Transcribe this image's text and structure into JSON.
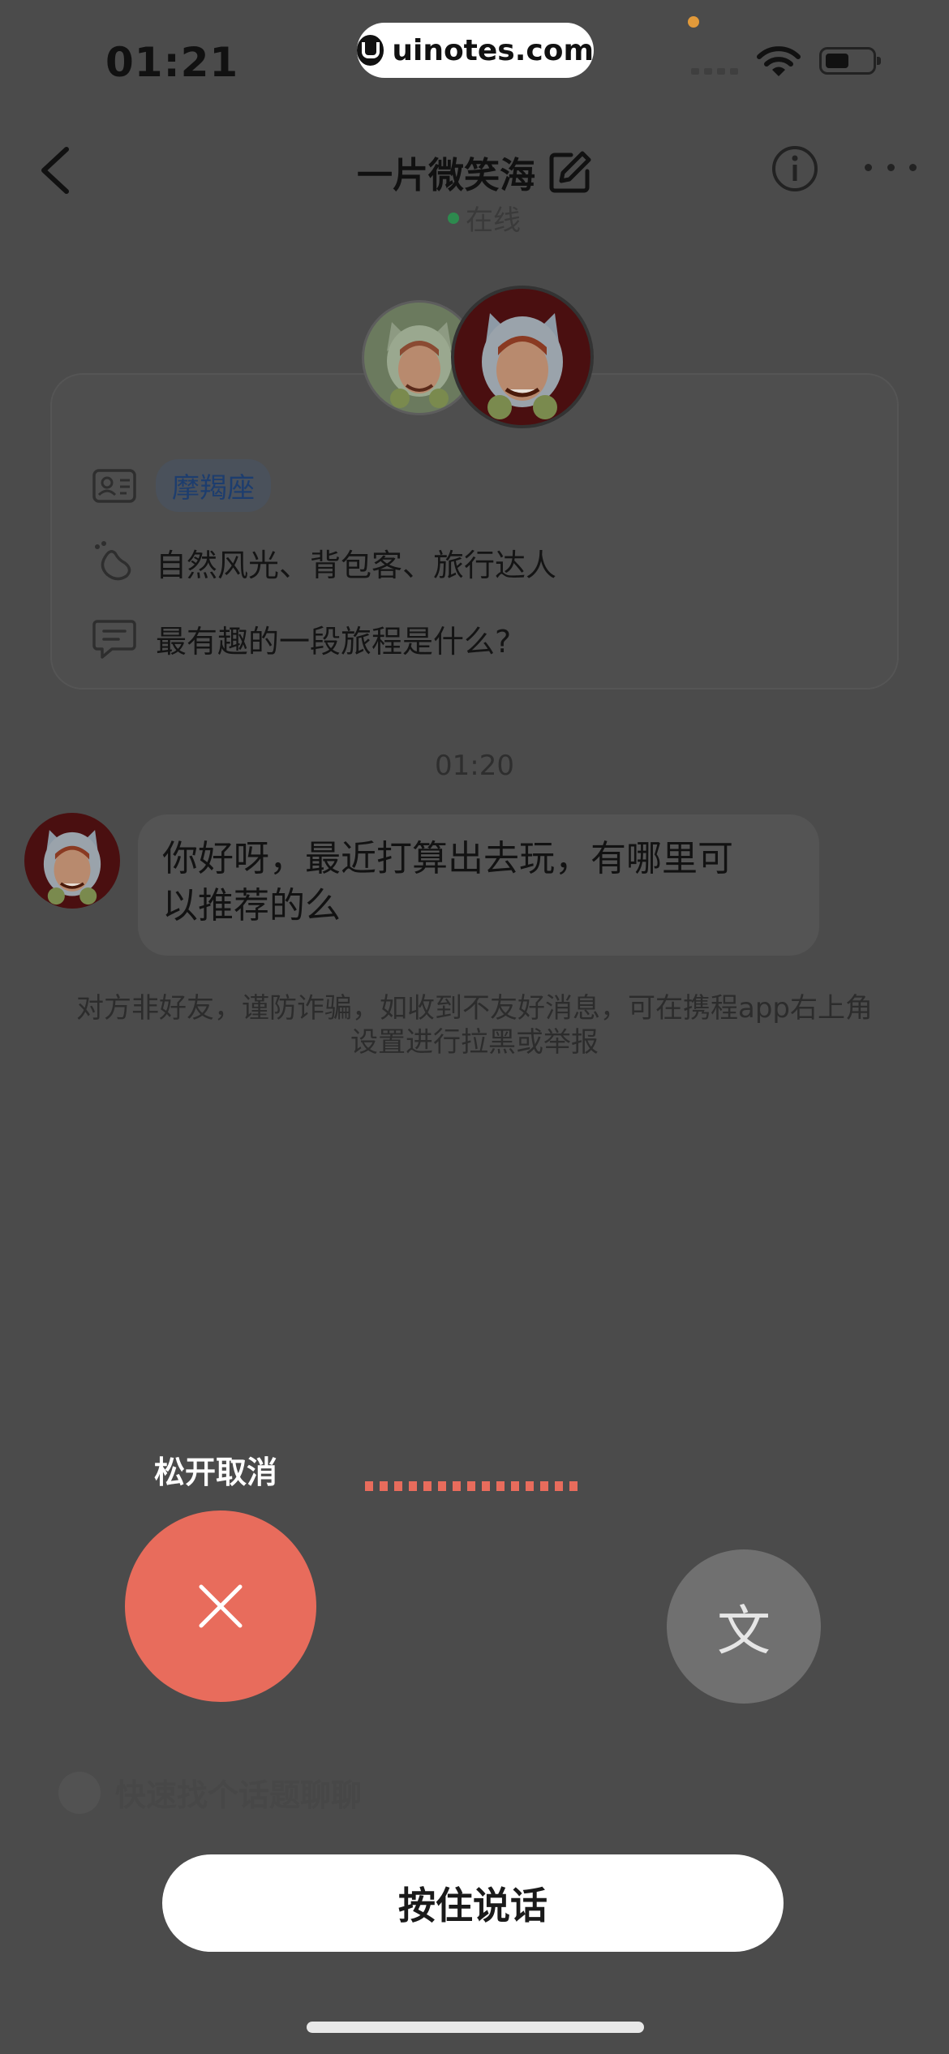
{
  "status_bar": {
    "time": "01:21",
    "watermark": "uinotes.com",
    "icons": [
      "signal-icon",
      "wifi-icon",
      "battery-icon"
    ]
  },
  "header": {
    "title": "一片微笑海",
    "status": "在线",
    "icons": [
      "back-icon",
      "edit-icon",
      "info-icon",
      "more-icon"
    ]
  },
  "profile": {
    "zodiac": "摩羯座",
    "interests": "自然风光、背包客、旅行达人",
    "question": "最有趣的一段旅程是什么?"
  },
  "chat": {
    "timestamp": "01:20",
    "message_line1": "你好呀，最近打算出去玩，有哪里可",
    "message_line2": "以推荐的么",
    "notice_line1": "对方非好友，谨防诈骗，如收到不友好消息，可在携程app右上角",
    "notice_line2": "设置进行拉黑或举报"
  },
  "voice": {
    "release_cancel": "松开取消",
    "convert_label": "文",
    "quick_topic": "快速找个话题聊聊",
    "hold_to_talk": "按住说话"
  },
  "colors": {
    "accent_red": "#e86c5c",
    "online_green": "#2d8a4e",
    "overlay": "#4b4b4b"
  }
}
